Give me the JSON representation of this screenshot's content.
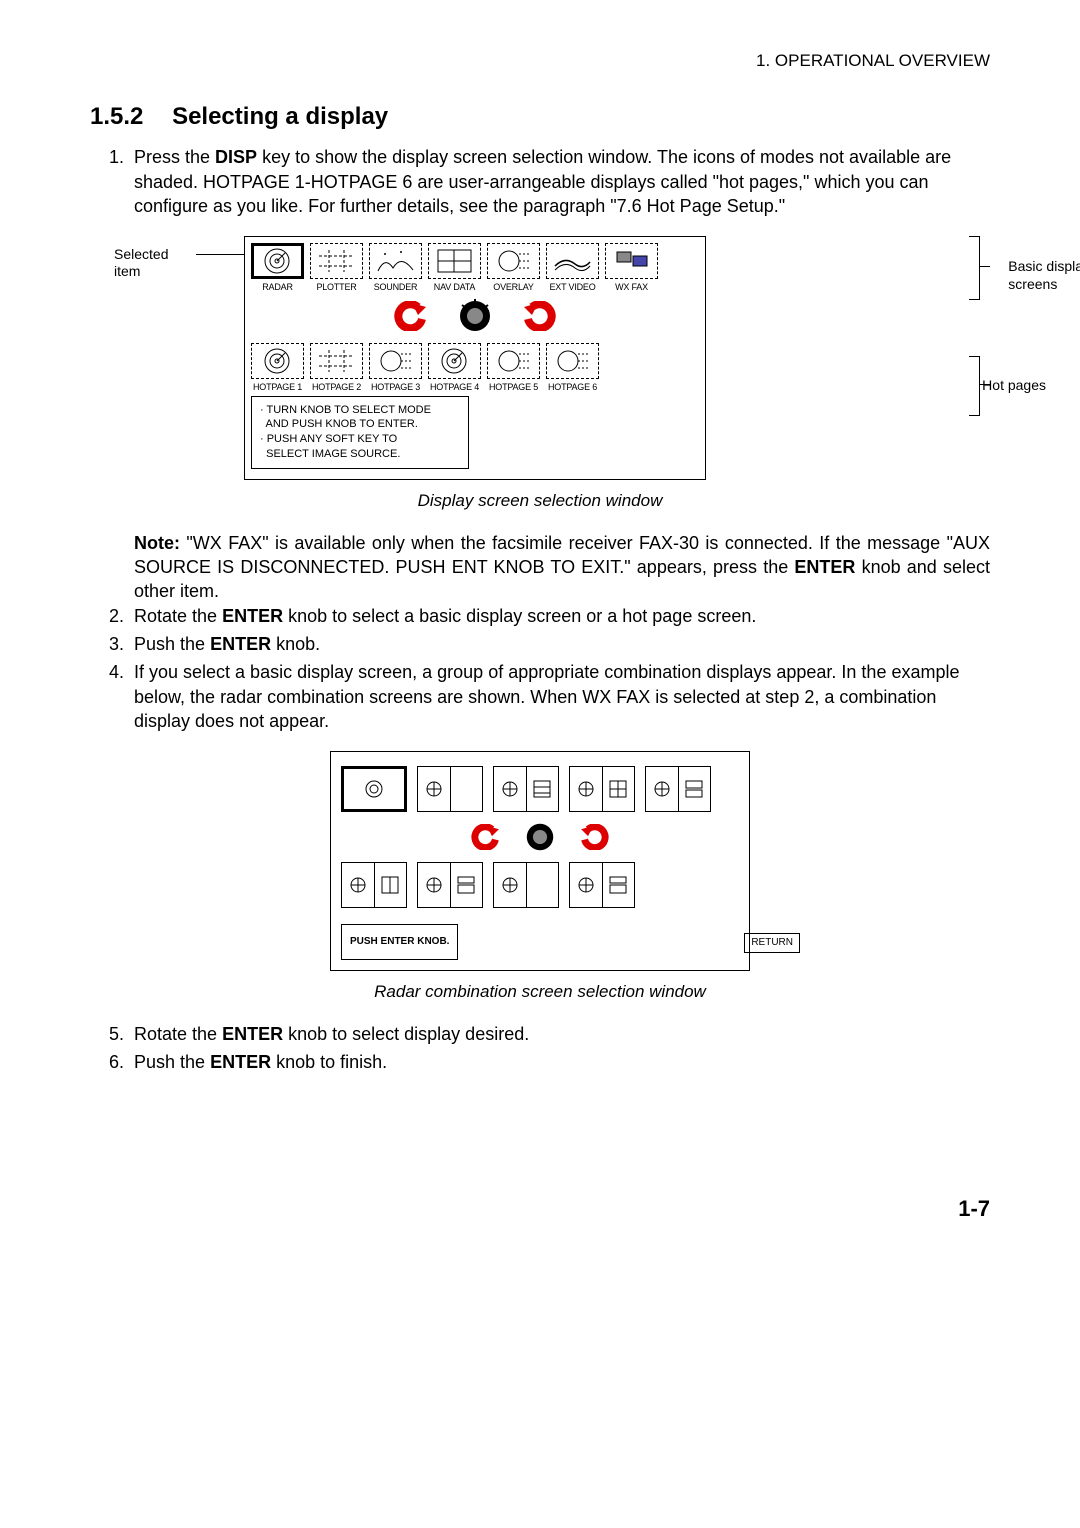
{
  "header": "1. OPERATIONAL OVERVIEW",
  "section": {
    "number": "1.5.2",
    "title": "Selecting a display"
  },
  "steps_a": [
    {
      "n": "1.",
      "before": "Press the ",
      "bold": "DISP",
      "after": " key to show the display screen selection window. The icons of modes not available are shaded. HOTPAGE 1-HOTPAGE 6 are user-arrangeable displays called \"hot pages,\" which you can configure as you like. For further details, see the paragraph \"7.6 Hot Page Setup.\""
    }
  ],
  "fig1": {
    "annot_left": "Selected\nitem",
    "annot_right_top": "Basic display\nscreens",
    "annot_right_bot": "Hot pages",
    "basic": [
      {
        "label": "RADAR",
        "selected": true,
        "icon": "radar"
      },
      {
        "label": "PLOTTER",
        "icon": "plotter"
      },
      {
        "label": "SOUNDER",
        "icon": "sounder"
      },
      {
        "label": "NAV DATA",
        "icon": "nav"
      },
      {
        "label": "OVERLAY",
        "icon": "overlay"
      },
      {
        "label": "EXT VIDEO",
        "icon": "ext"
      },
      {
        "label": "WX FAX",
        "icon": "wx"
      }
    ],
    "hot": [
      {
        "label": "HOTPAGE 1",
        "icon": "radar"
      },
      {
        "label": "HOTPAGE 2",
        "icon": "plotter"
      },
      {
        "label": "HOTPAGE 3",
        "icon": "overlay"
      },
      {
        "label": "HOTPAGE 4",
        "icon": "radar"
      },
      {
        "label": "HOTPAGE 5",
        "icon": "overlay"
      },
      {
        "label": "HOTPAGE 6",
        "icon": "overlay"
      }
    ],
    "instructions": "· TURN KNOB TO SELECT MODE\n  AND PUSH KNOB TO ENTER.\n· PUSH ANY SOFT KEY TO\n  SELECT IMAGE SOURCE.",
    "caption": "Display screen selection window"
  },
  "note_block": {
    "before": "Note:",
    "text": " \"WX FAX\" is available only when the facsimile receiver FAX-30 is connected. If the message \"AUX SOURCE IS DISCONNECTED. PUSH ENT KNOB TO EXIT.\" appears, press the ",
    "bold": "ENTER",
    "after": " knob and select other item."
  },
  "steps_b": [
    {
      "n": "2.",
      "before": "Rotate the ",
      "bold": "ENTER",
      "after": " knob to select a basic display screen or a hot page screen."
    },
    {
      "n": "3.",
      "before": "Push the ",
      "bold": "ENTER",
      "after": " knob."
    },
    {
      "n": "4.",
      "before": "",
      "bold": "",
      "after": "If you select a basic display screen, a group of appropriate combination displays appear. In the example below, the radar combination screens are shown. When WX FAX is selected at step 2, a combination display does not appear."
    }
  ],
  "fig2": {
    "prompt": "PUSH ENTER KNOB.",
    "return": "RETURN",
    "caption": "Radar combination screen selection window"
  },
  "steps_c": [
    {
      "n": "5.",
      "before": "Rotate the ",
      "bold": "ENTER",
      "after": " knob to select display desired."
    },
    {
      "n": "6.",
      "before": "Push the ",
      "bold": "ENTER",
      "after": " knob to finish."
    }
  ],
  "page_number": "1-7"
}
